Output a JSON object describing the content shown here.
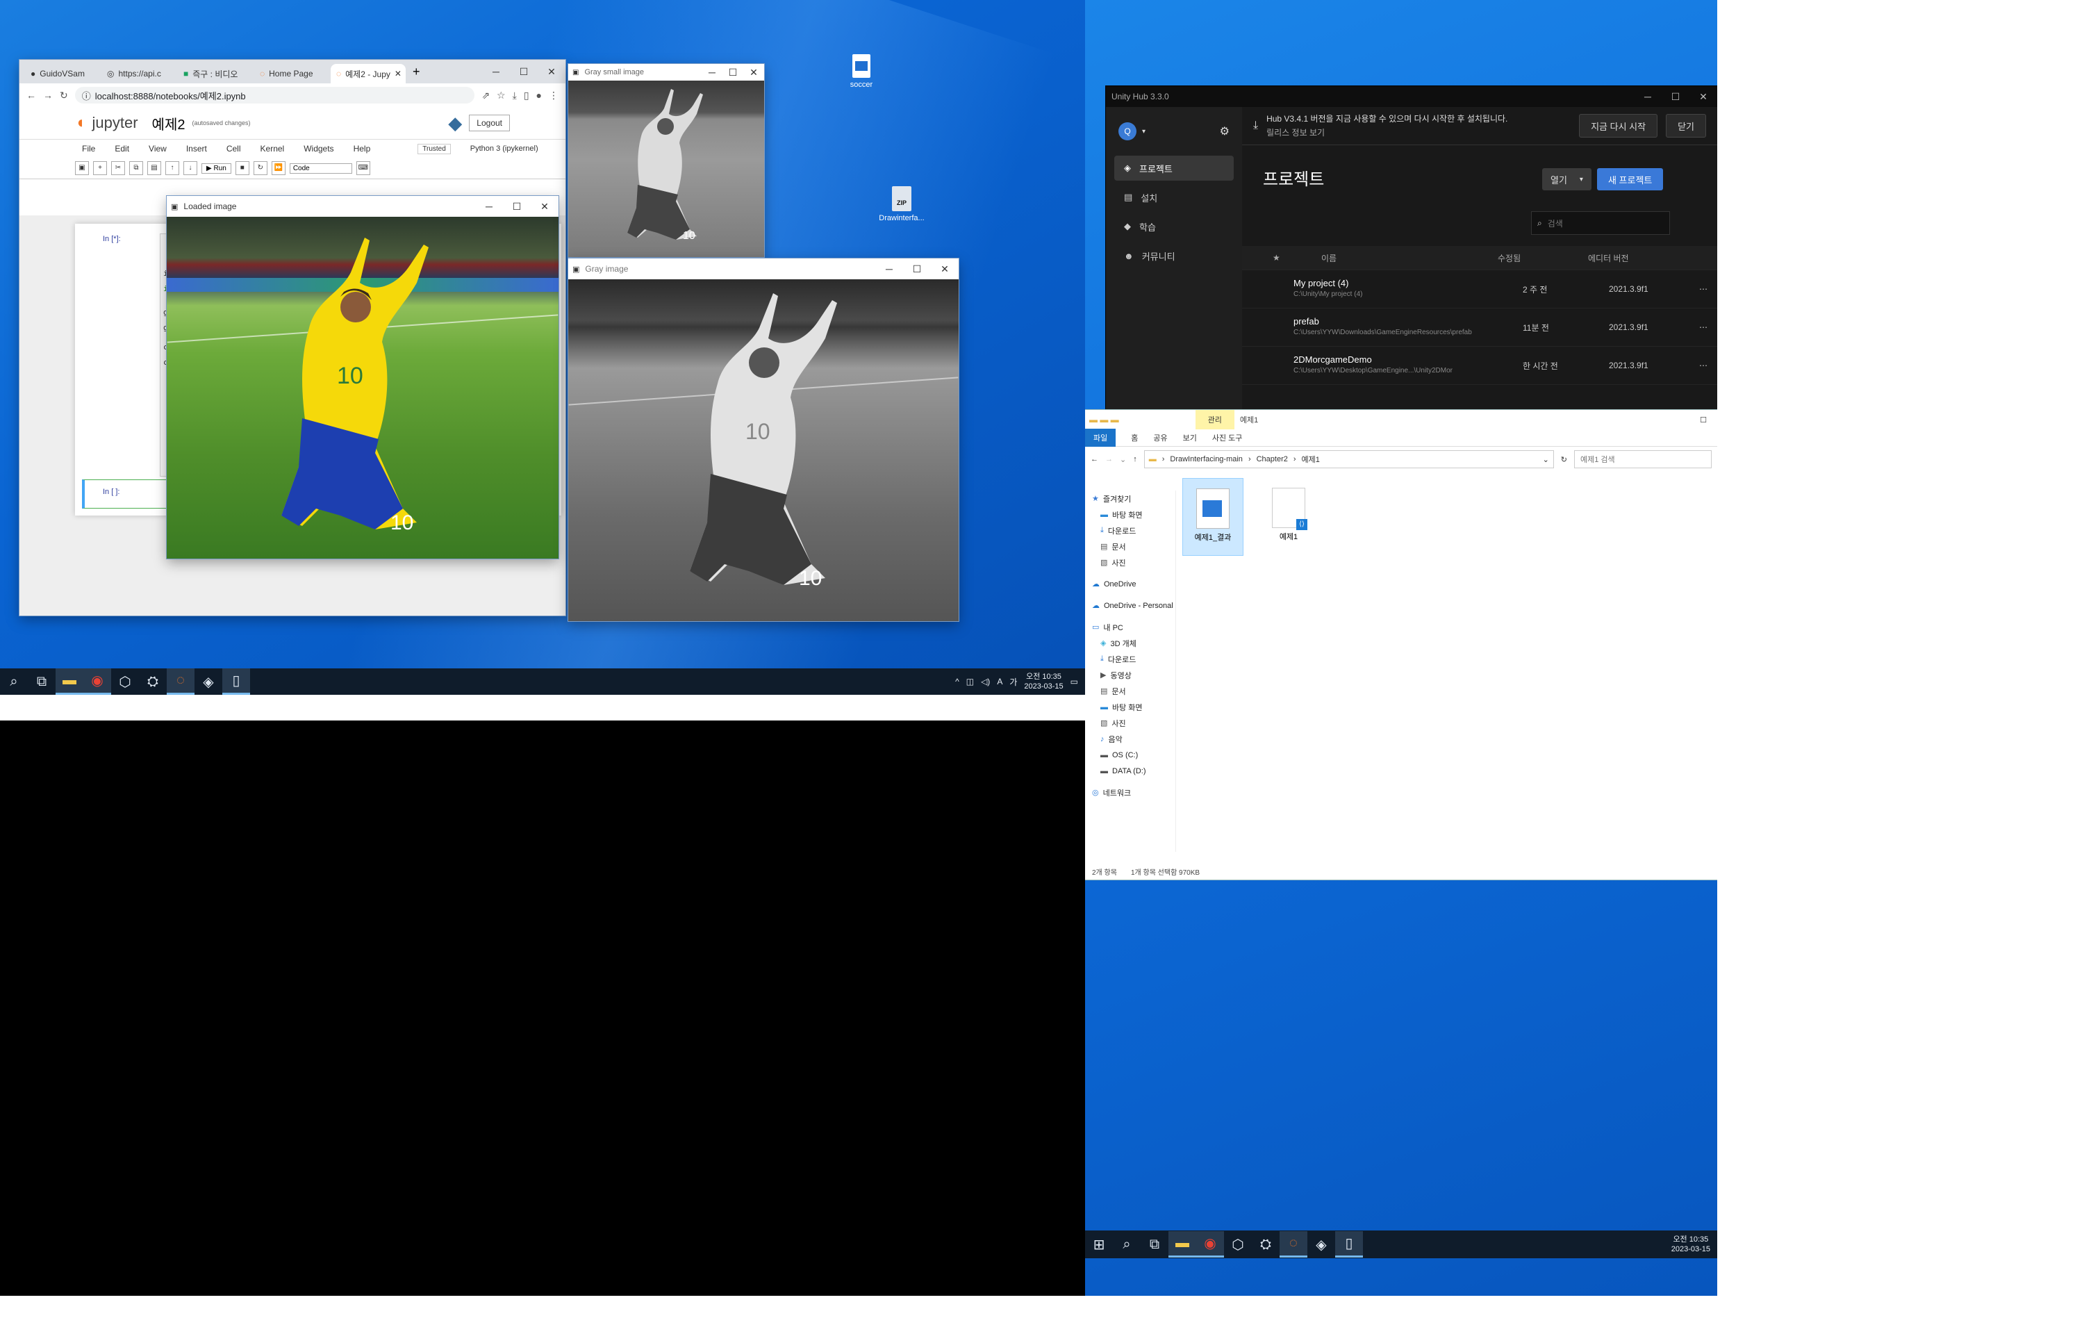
{
  "desktop": {
    "icons": [
      {
        "label": "soccer",
        "icon": "image-file-icon"
      },
      {
        "label": "Drawinterfa...",
        "icon": "zip-icon"
      }
    ]
  },
  "taskbar_left": {
    "clock_time": "오전 10:35",
    "clock_date": "2023-03-15",
    "tray_input": "A",
    "tray_lang": "가"
  },
  "taskbar_right": {
    "clock_time": "오전 10:35",
    "clock_date": "2023-03-15"
  },
  "chrome": {
    "tabs": [
      {
        "label": "GuidoVSam"
      },
      {
        "label": "https://api.c"
      },
      {
        "label": "즉구 : 비디오"
      },
      {
        "label": "Home Page"
      },
      {
        "label": "예제2 - Jupy"
      }
    ],
    "url": "localhost:8888/notebooks/예제2.ipynb",
    "jupyter": {
      "logo": "jupyter",
      "notebook_name": "예제2",
      "autosave": "(autosaved changes)",
      "logout": "Logout",
      "menu": [
        "File",
        "Edit",
        "View",
        "Insert",
        "Cell",
        "Kernel",
        "Widgets",
        "Help"
      ],
      "trusted": "Trusted",
      "kernel": "Python 3 (ipykernel)",
      "cell_type": "Code",
      "run_label": "Run",
      "prompt1": "In [*]:",
      "prompt2": "In [ ]:",
      "code_lines": [
        "im",
        "im",
        "gr",
        "gr",
        "cv",
        "cv",
        "cv",
        "cv",
        "cv",
        "cv"
      ]
    }
  },
  "windows": {
    "loaded_image": {
      "title": "Loaded image"
    },
    "gray_small": {
      "title": "Gray small image"
    },
    "gray_image": {
      "title": "Gray image"
    }
  },
  "unity": {
    "title": "Unity Hub 3.3.0",
    "update_msg": "Hub V3.4.1 버전을 지금 사용할 수 있으며 다시 시작한 후 설치됩니다.",
    "update_link": "릴리스 정보 보기",
    "restart_btn": "지금 다시 시작",
    "close_btn": "닫기",
    "sidebar": [
      "프로젝트",
      "설치",
      "학습",
      "커뮤니티"
    ],
    "heading": "프로젝트",
    "open_btn": "열기",
    "new_btn": "새 프로젝트",
    "search_placeholder": "검색",
    "columns": [
      "이름",
      "수정됨",
      "에디터 버전"
    ],
    "projects": [
      {
        "name": "My project (4)",
        "path": "C:\\Unity\\My project (4)",
        "modified": "2 주 전",
        "version": "2021.3.9f1"
      },
      {
        "name": "prefab",
        "path": "C:\\Users\\YYW\\Downloads\\GameEngineResources\\prefab",
        "modified": "11분 전",
        "version": "2021.3.9f1"
      },
      {
        "name": "2DMorcgameDemo",
        "path": "C:\\Users\\YYW\\Desktop\\GameEngine...\\Unity2DMor",
        "modified": "한 시간 전",
        "version": "2021.3.9f1"
      }
    ]
  },
  "explorer": {
    "title": "예제1",
    "context_tab": "관리",
    "ribbon_tabs": [
      "파일",
      "홈",
      "공유",
      "보기",
      "사진 도구"
    ],
    "breadcrumb": [
      "DrawInterfacing-main",
      "Chapter2",
      "예제1"
    ],
    "search_placeholder": "예제1 검색",
    "tree": [
      {
        "label": "즐겨찾기",
        "indent": 0,
        "icon": "star-icon"
      },
      {
        "label": "바탕 화면",
        "indent": 1,
        "icon": "desktop-icon"
      },
      {
        "label": "다운로드",
        "indent": 1,
        "icon": "download-icon"
      },
      {
        "label": "문서",
        "indent": 1,
        "icon": "document-icon"
      },
      {
        "label": "사진",
        "indent": 1,
        "icon": "picture-icon"
      },
      {
        "label": "",
        "indent": 0,
        "icon": "spacer"
      },
      {
        "label": "OneDrive",
        "indent": 0,
        "icon": "cloud-icon"
      },
      {
        "label": "",
        "indent": 0,
        "icon": "spacer"
      },
      {
        "label": "OneDrive - Personal",
        "indent": 0,
        "icon": "cloud-icon"
      },
      {
        "label": "",
        "indent": 0,
        "icon": "spacer"
      },
      {
        "label": "내 PC",
        "indent": 0,
        "icon": "pc-icon"
      },
      {
        "label": "3D 개체",
        "indent": 1,
        "icon": "cube-icon"
      },
      {
        "label": "다운로드",
        "indent": 1,
        "icon": "download-icon"
      },
      {
        "label": "동영상",
        "indent": 1,
        "icon": "video-icon"
      },
      {
        "label": "문서",
        "indent": 1,
        "icon": "document-icon"
      },
      {
        "label": "바탕 화면",
        "indent": 1,
        "icon": "desktop-icon"
      },
      {
        "label": "사진",
        "indent": 1,
        "icon": "picture-icon"
      },
      {
        "label": "음악",
        "indent": 1,
        "icon": "music-icon"
      },
      {
        "label": "OS (C:)",
        "indent": 1,
        "icon": "drive-icon"
      },
      {
        "label": "DATA (D:)",
        "indent": 1,
        "icon": "drive-icon"
      },
      {
        "label": "",
        "indent": 0,
        "icon": "spacer"
      },
      {
        "label": "네트워크",
        "indent": 0,
        "icon": "network-icon"
      }
    ],
    "files": [
      {
        "label": "예제1_결과",
        "icon": "image-file-icon"
      },
      {
        "label": "예제1",
        "icon": "py-file-icon"
      }
    ],
    "status_count": "2개 항목",
    "status_selected": "1개 항목 선택함 970KB"
  }
}
